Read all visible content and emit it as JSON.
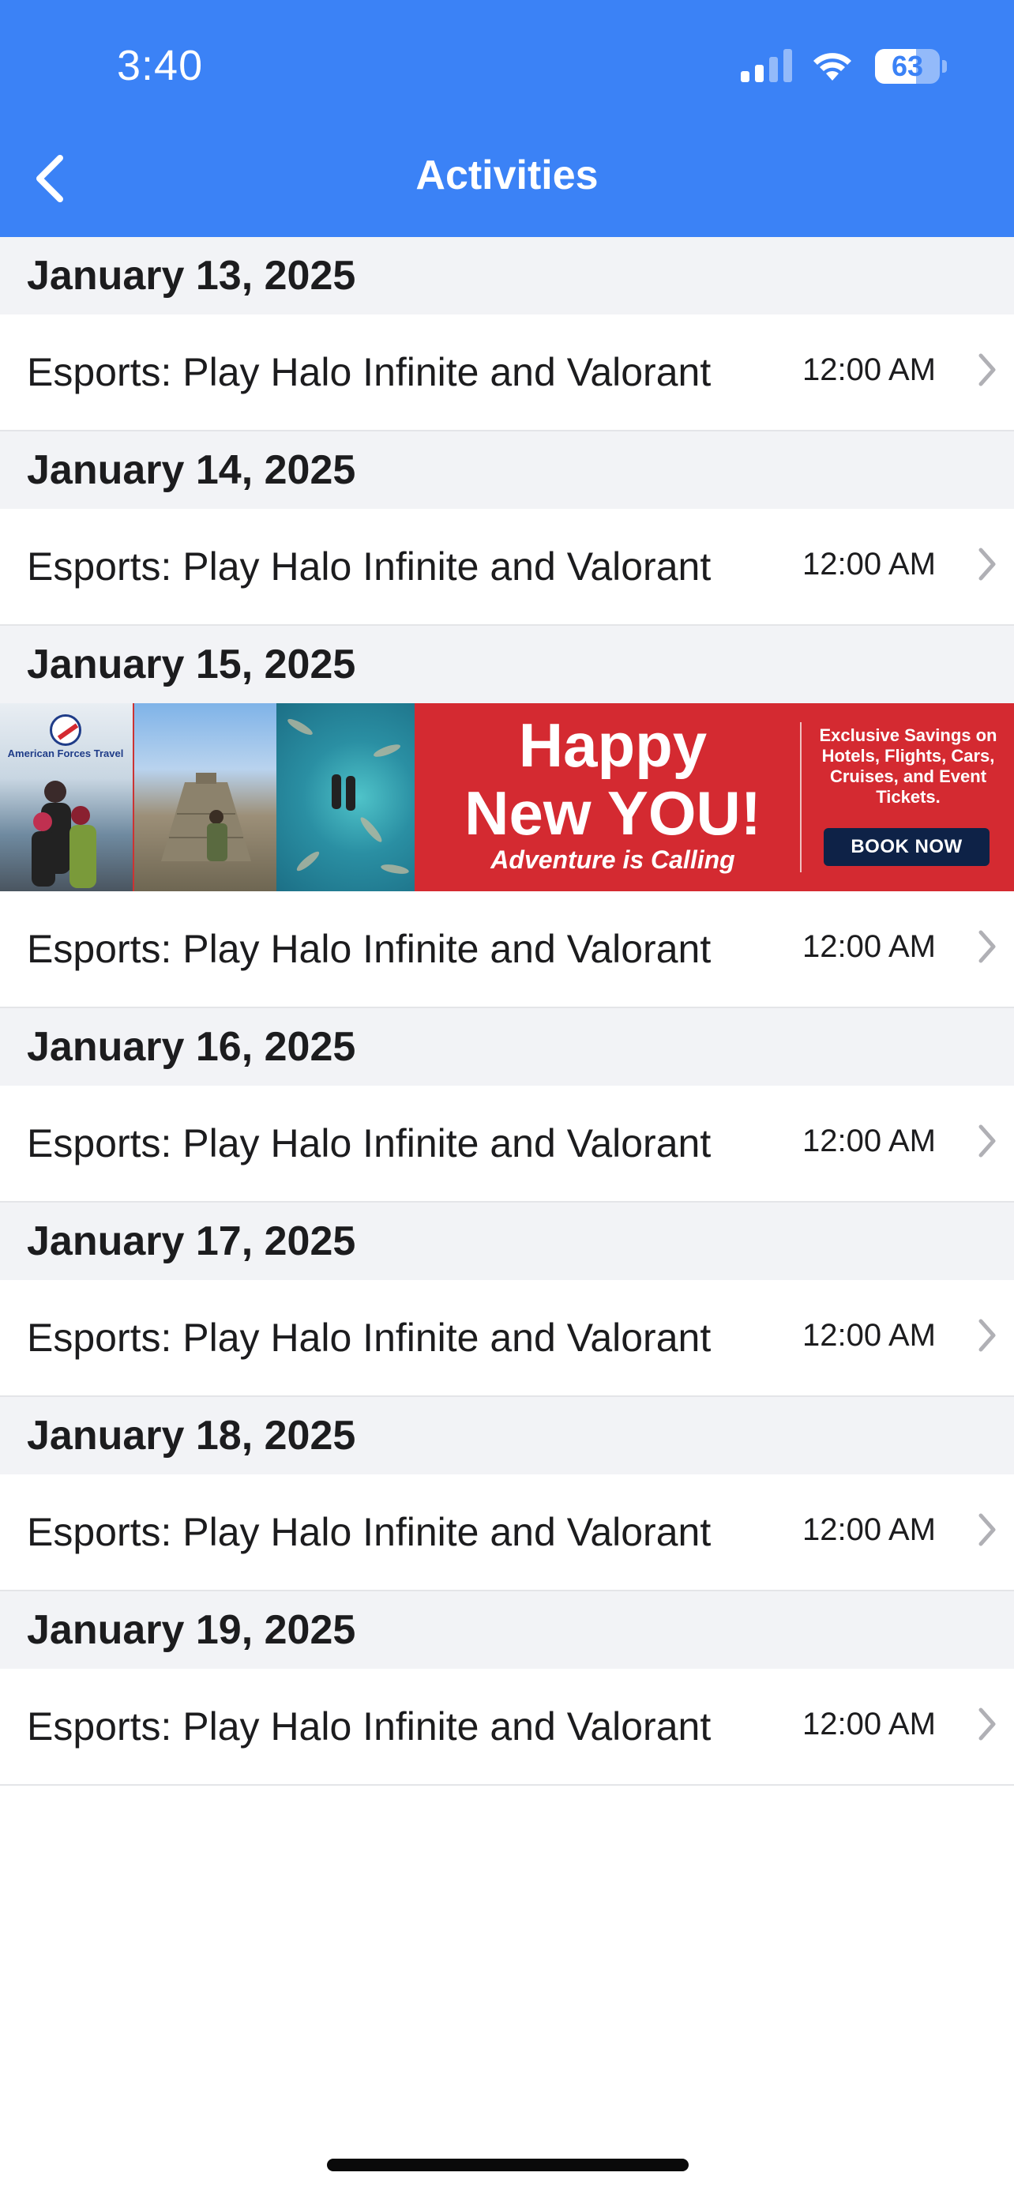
{
  "status_bar": {
    "time": "3:40",
    "battery_level": "63",
    "battery_fraction": 0.63
  },
  "nav": {
    "title": "Activities",
    "back_icon": "chevron-left-icon"
  },
  "days": [
    {
      "date": "January 13, 2025",
      "items": [
        {
          "title": "Esports: Play Halo Infinite and Valorant",
          "time": "12:00 AM"
        }
      ]
    },
    {
      "date": "January 14, 2025",
      "items": [
        {
          "title": "Esports: Play Halo Infinite and Valorant",
          "time": "12:00 AM"
        }
      ]
    },
    {
      "date": "January 15, 2025",
      "items": [
        {
          "title": "Esports: Play Halo Infinite and Valorant",
          "time": "12:00 AM"
        }
      ]
    },
    {
      "date": "January 16, 2025",
      "items": [
        {
          "title": "Esports: Play Halo Infinite and Valorant",
          "time": "12:00 AM"
        }
      ]
    },
    {
      "date": "January 17, 2025",
      "items": [
        {
          "title": "Esports: Play Halo Infinite and Valorant",
          "time": "12:00 AM"
        }
      ]
    },
    {
      "date": "January 18, 2025",
      "items": [
        {
          "title": "Esports: Play Halo Infinite and Valorant",
          "time": "12:00 AM"
        }
      ]
    },
    {
      "date": "January 19, 2025",
      "items": [
        {
          "title": "Esports: Play Halo Infinite and Valorant",
          "time": "12:00 AM"
        }
      ]
    }
  ],
  "ad": {
    "logo_text": "American Forces Travel",
    "headline_line1": "Happy",
    "headline_line2": "New YOU!",
    "tagline": "Adventure is Calling",
    "savings_text": "Exclusive Savings on Hotels, Flights, Cars, Cruises, and Event Tickets.",
    "cta": "BOOK NOW",
    "colors": {
      "banner": "#d42a31",
      "cta_bg": "#0e2247"
    }
  },
  "colors": {
    "header": "#3b82f6",
    "section_bg": "#f2f3f6",
    "chevron": "#b0b0b5"
  }
}
